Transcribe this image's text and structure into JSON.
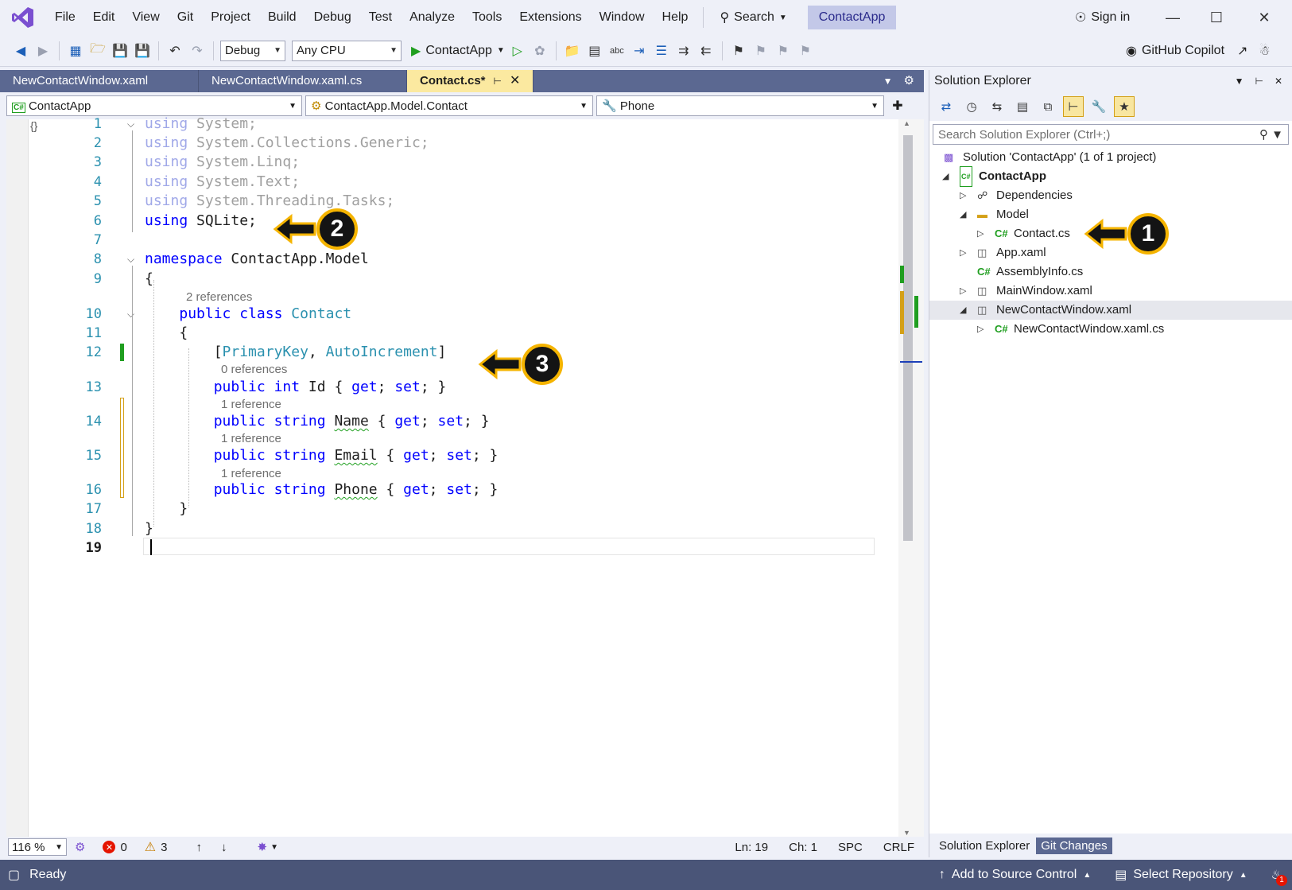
{
  "menu": {
    "items": [
      "File",
      "Edit",
      "View",
      "Git",
      "Project",
      "Build",
      "Debug",
      "Test",
      "Analyze",
      "Tools",
      "Extensions",
      "Window",
      "Help"
    ],
    "search_label": "Search",
    "app_name": "ContactApp",
    "sign_in": "Sign in"
  },
  "toolbar": {
    "config": "Debug",
    "platform": "Any CPU",
    "run_target": "ContactApp",
    "copilot": "GitHub Copilot"
  },
  "tabs": [
    {
      "label": "NewContactWindow.xaml",
      "active": false
    },
    {
      "label": "NewContactWindow.xaml.cs",
      "active": false
    },
    {
      "label": "Contact.cs*",
      "active": true
    }
  ],
  "navbar": {
    "project": "ContactApp",
    "type": "ContactApp.Model.Contact",
    "member": "Phone"
  },
  "editor": {
    "lines": [
      {
        "n": "1",
        "html": "<span class='dimkw'>using</span><span class='dim'> System;</span>"
      },
      {
        "n": "2",
        "html": "<span class='dimkw'>using</span><span class='dim'> System.Collections.Generic;</span>"
      },
      {
        "n": "3",
        "html": "<span class='dimkw'>using</span><span class='dim'> System.Linq;</span>"
      },
      {
        "n": "4",
        "html": "<span class='dimkw'>using</span><span class='dim'> System.Text;</span>"
      },
      {
        "n": "5",
        "html": "<span class='dimkw'>using</span><span class='dim'> System.Threading.Tasks;</span>"
      },
      {
        "n": "6",
        "html": "<span class='kw'>using</span> SQLite;"
      },
      {
        "n": "7",
        "html": ""
      },
      {
        "n": "8",
        "html": "<span class='kw'>namespace</span> ContactApp.Model"
      },
      {
        "n": "9",
        "html": "{"
      },
      {
        "n": "10",
        "html": "    <span class='kw'>public</span> <span class='kw'>class</span> <span class='ty'>Contact</span>"
      },
      {
        "n": "11",
        "html": "    {"
      },
      {
        "n": "12",
        "html": "        [<span class='ty'>PrimaryKey</span>, <span class='ty'>AutoIncrement</span>]"
      },
      {
        "n": "13",
        "html": "        <span class='kw'>public</span> <span class='kw'>int</span> Id { <span class='kw'>get</span>; <span class='kw'>set</span>; }"
      },
      {
        "n": "14",
        "html": "        <span class='kw'>public</span> <span class='kw'>string</span> <span class='squig'>Name</span> { <span class='kw'>get</span>; <span class='kw'>set</span>; }"
      },
      {
        "n": "15",
        "html": "        <span class='kw'>public</span> <span class='kw'>string</span> <span class='squig'>Email</span> { <span class='kw'>get</span>; <span class='kw'>set</span>; }"
      },
      {
        "n": "16",
        "html": "        <span class='kw'>public</span> <span class='kw'>string</span> <span class='squig'>Phone</span> { <span class='kw'>get</span>; <span class='kw'>set</span>; }"
      },
      {
        "n": "17",
        "html": "    }"
      },
      {
        "n": "18",
        "html": "}"
      },
      {
        "n": "19",
        "html": ""
      }
    ],
    "lens": {
      "class_refs": "2 references",
      "id_refs": "0 references",
      "name_refs": "1 reference",
      "email_refs": "1 reference",
      "phone_refs": "1 reference"
    }
  },
  "editor_status": {
    "zoom": "116 %",
    "errors": "0",
    "warnings": "3",
    "line": "Ln: 19",
    "col": "Ch: 1",
    "spc": "SPC",
    "eol": "CRLF"
  },
  "solution_explorer": {
    "title": "Solution Explorer",
    "search_placeholder": "Search Solution Explorer (Ctrl+;)",
    "tree": [
      {
        "label": "Solution 'ContactApp' (1 of 1 project)"
      },
      {
        "label": "ContactApp"
      },
      {
        "label": "Dependencies"
      },
      {
        "label": "Model"
      },
      {
        "label": "Contact.cs"
      },
      {
        "label": "App.xaml"
      },
      {
        "label": "AssemblyInfo.cs"
      },
      {
        "label": "MainWindow.xaml"
      },
      {
        "label": "NewContactWindow.xaml"
      },
      {
        "label": "NewContactWindow.xaml.cs"
      }
    ],
    "tab_active": "Solution Explorer",
    "tab_other": "Git Changes"
  },
  "statusbar": {
    "ready": "Ready",
    "source_control": "Add to Source Control",
    "repository": "Select Repository",
    "notifications": "1"
  },
  "callouts": [
    "1",
    "2",
    "3"
  ],
  "colors": {
    "accent": "#5b6891",
    "highlight": "#f5b400",
    "status_bar": "#4a5578"
  }
}
